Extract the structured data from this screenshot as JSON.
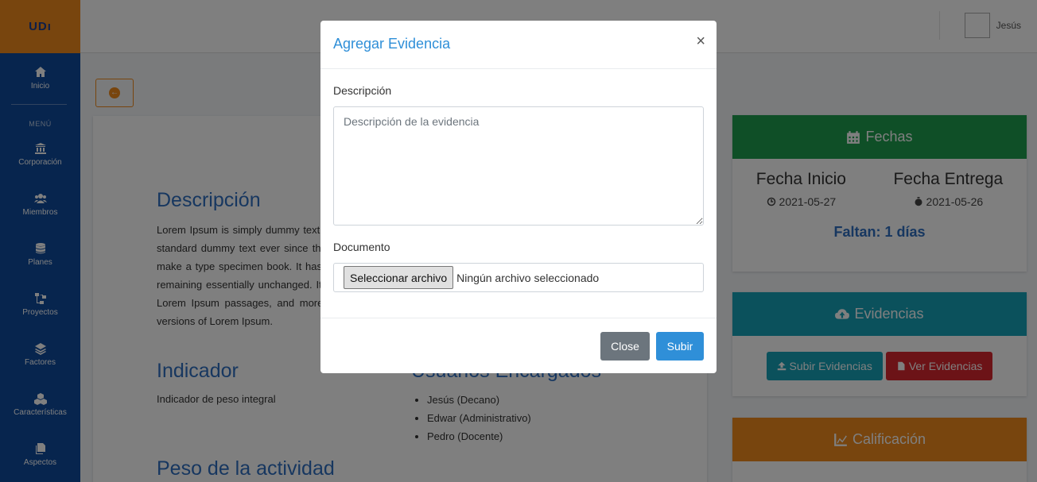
{
  "brand": "UDı",
  "sidebar": {
    "items": [
      {
        "label": "Inicio",
        "icon": "home-icon"
      },
      {
        "label": "Corporación",
        "icon": "institution-icon"
      },
      {
        "label": "Miembros",
        "icon": "users-icon"
      },
      {
        "label": "Planes",
        "icon": "database-icon"
      },
      {
        "label": "Proyectos",
        "icon": "sitemap-icon"
      },
      {
        "label": "Factores",
        "icon": "layers-icon"
      },
      {
        "label": "Características",
        "icon": "cubes-icon"
      },
      {
        "label": "Aspectos",
        "icon": "copy-icon"
      }
    ],
    "menu_heading": "MENÚ"
  },
  "topbar": {
    "user_name": "Jesús"
  },
  "content": {
    "descripcion_title": "Descripción",
    "descripcion_text": "Lorem Ipsum is simply dummy text of the printing and typesetting industry. Lorem Ipsum has been the industry's standard dummy text ever since the 1500s, when an unknown printer took a galley of type and scrambled it to make a type specimen book. It has survived not only five centuries, but also the leap into electronic typesetting, remaining essentially unchanged. It was popularised in the 1960s with the release of Letraset sheets containing Lorem Ipsum passages, and more recently with desktop publishing software like Aldus PageMaker including versions of Lorem Ipsum.",
    "indicador_title": "Indicador",
    "indicador_text": "Indicador de peso integral",
    "usuarios_title": "Usuarios Encargados",
    "usuarios": [
      "Jesús (Decano)",
      "Edwar (Administrativo)",
      "Pedro (Docente)"
    ],
    "peso_title": "Peso de la actividad"
  },
  "fechas": {
    "title": "Fechas",
    "inicio_label": "Fecha Inicio",
    "inicio_value": "2021-05-27",
    "entrega_label": "Fecha Entrega",
    "entrega_value": "2021-05-26",
    "remaining": "Faltan: 1 días",
    "color": "#1e9e4f"
  },
  "evidencias": {
    "title": "Evidencias",
    "subir_label": "Subir Evidencias",
    "ver_label": "Ver Evidencias",
    "color": "#17a2b8"
  },
  "calificacion": {
    "title": "Calificación",
    "color": "#f08a1c"
  },
  "modal": {
    "title": "Agregar Evidencia",
    "close_symbol": "×",
    "description_label": "Descripción",
    "description_placeholder": "Descripción de la evidencia",
    "document_label": "Documento",
    "file_button": "Seleccionar archivo",
    "file_status": "Ningún archivo seleccionado",
    "close_button": "Close",
    "submit_button": "Subir"
  }
}
